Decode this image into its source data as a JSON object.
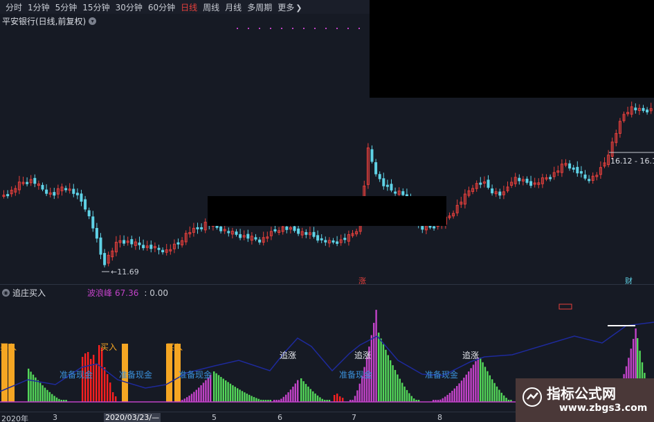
{
  "toolbar": {
    "timeframes": [
      "分时",
      "1分钟",
      "5分钟",
      "15分钟",
      "30分钟",
      "60分钟",
      "日线",
      "周线",
      "月线",
      "多周期",
      "更多"
    ],
    "active": "日线"
  },
  "stock": {
    "title": "平安银行(日线,前复权)"
  },
  "price_annotations": {
    "low": "11.69",
    "high_range": "16.12 - 16.1",
    "event_marks": [
      "涨",
      "财"
    ]
  },
  "indicator": {
    "name": "追庄买入",
    "legend_wave_label": "波浪峰",
    "legend_wave_value": "67.36",
    "legend_other_value": ": 0.00",
    "labels": {
      "buy": "买入",
      "chase": "追涨",
      "prepare": "准备现金"
    }
  },
  "axis": {
    "labels": [
      "2020年",
      "3",
      "2020/03/23/—",
      "5",
      "6",
      "7",
      "8"
    ]
  },
  "watermark": {
    "title": "指标公式网",
    "url": "www.zbgs3.com"
  },
  "colors": {
    "background": "#161a24",
    "up": "#e8403c",
    "down": "#5fd2e6",
    "buy_bar": "#f5a623",
    "green_bar": "#54d85a",
    "purple_bar": "#c243c8",
    "red_bar": "#ff2020",
    "line_blue": "#1e2a9c",
    "label_cyan": "#3a8fd8"
  }
}
